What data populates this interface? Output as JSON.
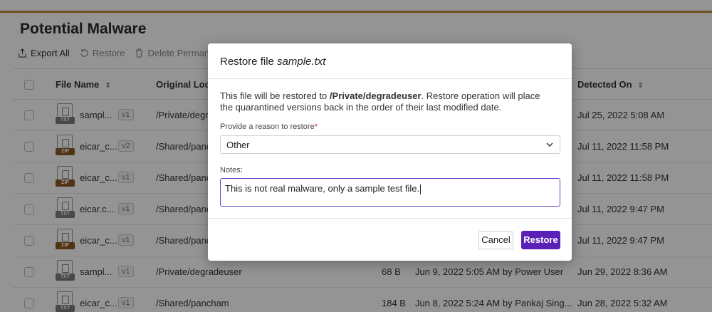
{
  "page": {
    "title": "Potential Malware"
  },
  "toolbar": {
    "export_all": "Export All",
    "restore": "Restore",
    "delete_permanently": "Delete Permane"
  },
  "table": {
    "headers": {
      "file_name": "File Name",
      "original_location": "Original Loca",
      "detected_on": "Detected On"
    },
    "rows": [
      {
        "icon": "TXT",
        "name": "sampl...",
        "version": "v1",
        "location": "/Private/degr",
        "size": "",
        "modified": "",
        "detected": "Jul 25, 2022 5:08 AM"
      },
      {
        "icon": "ZIP",
        "name": "eicar_c...",
        "version": "v2",
        "location": "/Shared/panc",
        "size": "",
        "modified": "",
        "detected": "Jul 11, 2022 11:58 PM"
      },
      {
        "icon": "ZIP",
        "name": "eicar_c...",
        "version": "v1",
        "location": "/Shared/panc",
        "size": "",
        "modified": "",
        "detected": "Jul 11, 2022 11:58 PM"
      },
      {
        "icon": "TXT",
        "name": "eicar.c...",
        "version": "v1",
        "location": "/Shared/panc",
        "size": "",
        "modified": "",
        "detected": "Jul 11, 2022 9:47 PM"
      },
      {
        "icon": "ZIP",
        "name": "eicar_c...",
        "version": "v1",
        "location": "/Shared/panc",
        "size": "",
        "modified": "",
        "detected": "Jul 11, 2022 9:47 PM"
      },
      {
        "icon": "TXT",
        "name": "sampl...",
        "version": "v1",
        "location": "/Private/degradeuser",
        "size": "68 B",
        "modified": "Jun 9, 2022 5:05 AM by Power User",
        "detected": "Jun 29, 2022 8:36 AM"
      },
      {
        "icon": "TXT",
        "name": "eicar_c...",
        "version": "v1",
        "location": "/Shared/pancham",
        "size": "184 B",
        "modified": "Jun 8, 2022 5:24 AM by Pankaj Sing...",
        "detected": "Jun 28, 2022 5:32 AM"
      }
    ]
  },
  "modal": {
    "title_prefix": "Restore file ",
    "title_file": "sample.txt",
    "desc_prefix": "This file will be restored to ",
    "desc_path": "/Private/degradeuser",
    "desc_suffix": ". Restore operation will place the quarantined versions back in the order of their last modified date.",
    "reason_label": "Provide a reason to restore",
    "reason_required_mark": "*",
    "reason_value": "Other",
    "notes_label": "Notes:",
    "notes_value": "This is not real malware, only a sample test file.",
    "cancel_label": "Cancel",
    "restore_label": "Restore"
  },
  "colors": {
    "accent": "#5b21b6",
    "topbar_border": "#c58a3a",
    "notes_focus": "#6a3ec2"
  }
}
